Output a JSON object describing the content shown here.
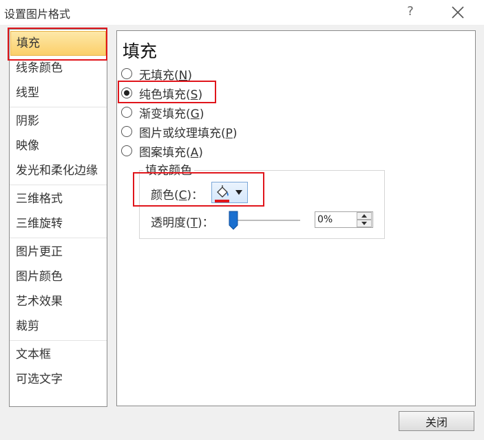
{
  "window": {
    "title": "设置图片格式",
    "help_label": "?"
  },
  "nav": {
    "groups": [
      [
        "填充",
        "线条颜色",
        "线型"
      ],
      [
        "阴影",
        "映像",
        "发光和柔化边缘"
      ],
      [
        "三维格式",
        "三维旋转"
      ],
      [
        "图片更正",
        "图片颜色",
        "艺术效果",
        "裁剪"
      ],
      [
        "文本框",
        "可选文字"
      ]
    ],
    "selected": "填充"
  },
  "panel": {
    "title": "填充",
    "fill_options": [
      {
        "label": "无填充",
        "key": "N",
        "checked": false
      },
      {
        "label": "纯色填充",
        "key": "S",
        "checked": true
      },
      {
        "label": "渐变填充",
        "key": "G",
        "checked": false
      },
      {
        "label": "图片或纹理填充",
        "key": "P",
        "checked": false
      },
      {
        "label": "图案填充",
        "key": "A",
        "checked": false
      }
    ],
    "group_title": "填充颜色",
    "color_label": "颜色",
    "color_key": "C",
    "color_swatch": "#e0151b",
    "transparency_label": "透明度",
    "transparency_key": "T",
    "transparency_value": "0%",
    "transparency_level": 0
  },
  "footer": {
    "close_label": "关闭"
  },
  "colors": {
    "highlight": "#e0151b",
    "accent": "#1a6fcf"
  }
}
